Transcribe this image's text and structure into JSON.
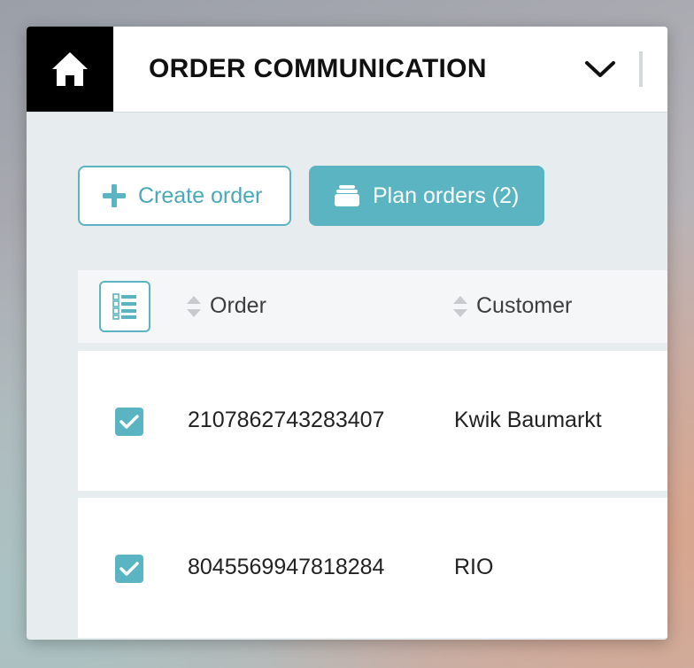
{
  "header": {
    "title": "ORDER COMMUNICATION",
    "home_icon": "home-icon",
    "expand_icon": "chevron-down-icon"
  },
  "actions": {
    "create_label": "Create order",
    "create_icon": "plus-icon",
    "plan_label": "Plan orders (2)",
    "plan_icon": "stack-icon"
  },
  "table": {
    "column_toggle_icon": "list-columns-icon",
    "columns": [
      "Order",
      "Customer"
    ],
    "rows": [
      {
        "order": "2107862743283407",
        "customer": "Kwik Baumarkt",
        "selected": true
      },
      {
        "order": "8045569947818284",
        "customer": "RIO",
        "selected": true
      }
    ]
  },
  "colors": {
    "accent": "#5bb4c2",
    "header_bg": "#ffffff",
    "home_bg": "#000000",
    "content_bg": "#e7ecef"
  }
}
